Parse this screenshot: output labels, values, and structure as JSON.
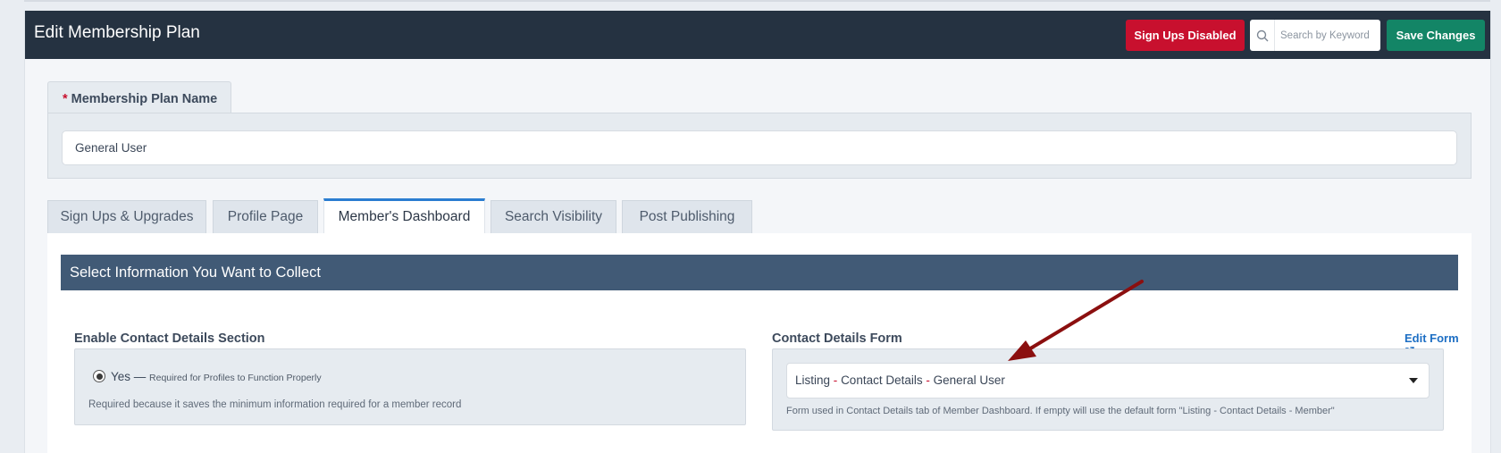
{
  "header": {
    "title": "Edit Membership Plan",
    "signups_button": "Sign Ups Disabled",
    "search_placeholder": "Search by Keyword",
    "save_button": "Save Changes"
  },
  "plan_name": {
    "tab_label": "Membership Plan Name",
    "required_marker": "*",
    "value": "General User"
  },
  "tabs": [
    {
      "label": "Sign Ups & Upgrades",
      "active": false
    },
    {
      "label": "Profile Page",
      "active": false
    },
    {
      "label": "Member's Dashboard",
      "active": true
    },
    {
      "label": "Search Visibility",
      "active": false
    },
    {
      "label": "Post Publishing",
      "active": false
    }
  ],
  "section": {
    "title": "Select Information You Want to Collect",
    "contact_section": {
      "label": "Enable Contact Details Section",
      "option": "Yes —",
      "option_note": "Required for Profiles to Function Properly",
      "help": "Required because it saves the minimum information required for a member record"
    },
    "contact_form": {
      "label": "Contact Details Form",
      "edit_link": "Edit Form",
      "selected": {
        "part1": "Listing",
        "sep": "-",
        "part2": "Contact Details",
        "part3": "General User"
      },
      "help": "Form used in Contact Details tab of Member Dashboard. If empty will use the default form \"Listing - Contact Details - Member\""
    }
  },
  "colors": {
    "header_bg": "#253241",
    "danger": "#c8102e",
    "success": "#138566",
    "section_bar": "#415a76",
    "link": "#1e6fc4",
    "annotation_arrow": "#8b0f0f"
  }
}
